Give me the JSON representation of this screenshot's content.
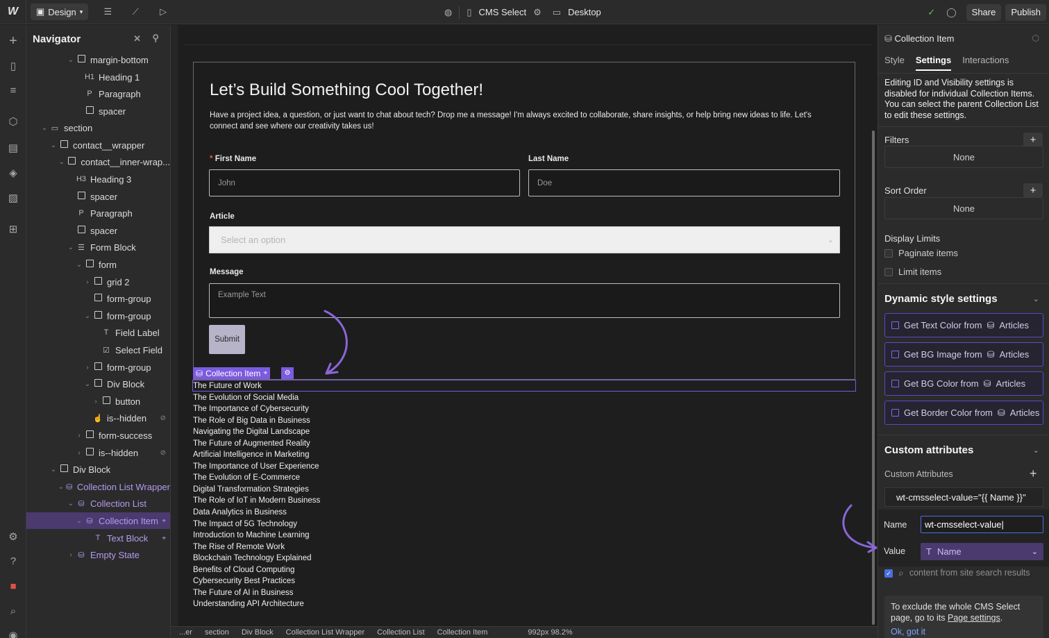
{
  "topbar": {
    "design_label": "Design",
    "page_label": "CMS Select",
    "breakpoint_label": "Desktop",
    "share_label": "Share",
    "publish_label": "Publish"
  },
  "navigator": {
    "title": "Navigator",
    "rows": [
      {
        "label": "margin-bottom",
        "icon": "box"
      },
      {
        "label": "Heading 1",
        "icon": "H1"
      },
      {
        "label": "Paragraph",
        "icon": "P"
      },
      {
        "label": "spacer",
        "icon": "box"
      },
      {
        "label": "section",
        "icon": "section"
      },
      {
        "label": "contact__wrapper",
        "icon": "box"
      },
      {
        "label": "contact__inner-wrap...",
        "icon": "box"
      },
      {
        "label": "Heading 3",
        "icon": "H3"
      },
      {
        "label": "spacer",
        "icon": "box"
      },
      {
        "label": "Paragraph",
        "icon": "P"
      },
      {
        "label": "spacer",
        "icon": "box"
      },
      {
        "label": "Form Block",
        "icon": "form"
      },
      {
        "label": "form",
        "icon": "box"
      },
      {
        "label": "grid 2",
        "icon": "box"
      },
      {
        "label": "form-group",
        "icon": "box"
      },
      {
        "label": "form-group",
        "icon": "box"
      },
      {
        "label": "Field Label",
        "icon": "T"
      },
      {
        "label": "Select Field",
        "icon": "check"
      },
      {
        "label": "form-group",
        "icon": "box"
      },
      {
        "label": "Div Block",
        "icon": "box"
      },
      {
        "label": "button",
        "icon": "box"
      },
      {
        "label": "is--hidden",
        "icon": "link"
      },
      {
        "label": "form-success",
        "icon": "box"
      },
      {
        "label": "is--hidden",
        "icon": "box"
      },
      {
        "label": "Div Block",
        "icon": "box"
      },
      {
        "label": "Collection List Wrapper",
        "icon": "db"
      },
      {
        "label": "Collection List",
        "icon": "db"
      },
      {
        "label": "Collection Item",
        "icon": "db"
      },
      {
        "label": "Text Block",
        "icon": "T"
      },
      {
        "label": "Empty State",
        "icon": "db"
      }
    ]
  },
  "canvas": {
    "title": "Let’s Build Something Cool Together!",
    "paragraph": "Have a project idea, a question, or just want to chat about tech? Drop me a message! I'm always excited to collaborate, share insights, or help bring new ideas to life. Let's connect and see where our creativity takes us!",
    "first_name_label": "First Name",
    "first_name_required": "*",
    "first_name_placeholder": "John",
    "last_name_label": "Last Name",
    "last_name_placeholder": "Doe",
    "article_label": "Article",
    "article_placeholder": "Select an option",
    "message_label": "Message",
    "message_placeholder": "Example Text",
    "submit_label": "Submit",
    "collection_item_tag": "Collection Item",
    "articles": [
      "The Future of Work",
      "The Evolution of Social Media",
      "The Importance of Cybersecurity",
      "The Role of Big Data in Business",
      "Navigating the Digital Landscape",
      "The Future of Augmented Reality",
      "Artificial Intelligence in Marketing",
      "The Importance of User Experience",
      "The Evolution of E-Commerce",
      "Digital Transformation Strategies",
      "The Role of IoT in Modern Business",
      "Data Analytics in Business",
      "The Impact of 5G Technology",
      "Introduction to Machine Learning",
      "The Rise of Remote Work",
      "Blockchain Technology Explained",
      "Benefits of Cloud Computing",
      "Cybersecurity Best Practices",
      "The Future of AI in Business",
      "Understanding API Architecture"
    ]
  },
  "bottombar": {
    "crumbs": [
      "...er",
      "section",
      "Div Block",
      "Collection List Wrapper",
      "Collection List",
      "Collection Item"
    ],
    "size": "992px 98.2%"
  },
  "rightpanel": {
    "header": "Collection Item",
    "tabs": [
      "Style",
      "Settings",
      "Interactions"
    ],
    "note": "Editing ID and Visibility settings is disabled for individual Collection Items. You can select the parent Collection List to edit these settings.",
    "filters_label": "Filters",
    "filters_value": "None",
    "sort_label": "Sort Order",
    "sort_value": "None",
    "display_limits_label": "Display Limits",
    "paginate_label": "Paginate items",
    "limit_label": "Limit items",
    "dynamic_title": "Dynamic style settings",
    "dynamic_buttons": [
      {
        "label": "Get Text Color from",
        "source": "Articles"
      },
      {
        "label": "Get BG Image from",
        "source": "Articles"
      },
      {
        "label": "Get BG Color from",
        "source": "Articles"
      },
      {
        "label": "Get Border Color from",
        "source": "Articles"
      }
    ],
    "custom_attr_title": "Custom attributes",
    "custom_attr_label": "Custom Attributes",
    "attr_row": "wt-cmsselect-value=\"{{ Name }}\"",
    "name_label": "Name",
    "name_value": "wt-cmsselect-value",
    "value_label": "Value",
    "value_field": "Name",
    "search_text": "content from site search results",
    "exclude_text": "To exclude the whole CMS Select page, go to its",
    "exclude_link": "Page settings",
    "ok_label": "Ok, got it"
  },
  "colors": {
    "accent_purple": "#7b5be0",
    "panel_bg": "#2b2b2b",
    "canvas_bg": "#1e1e1e",
    "link_blue": "#7ea6ff"
  }
}
